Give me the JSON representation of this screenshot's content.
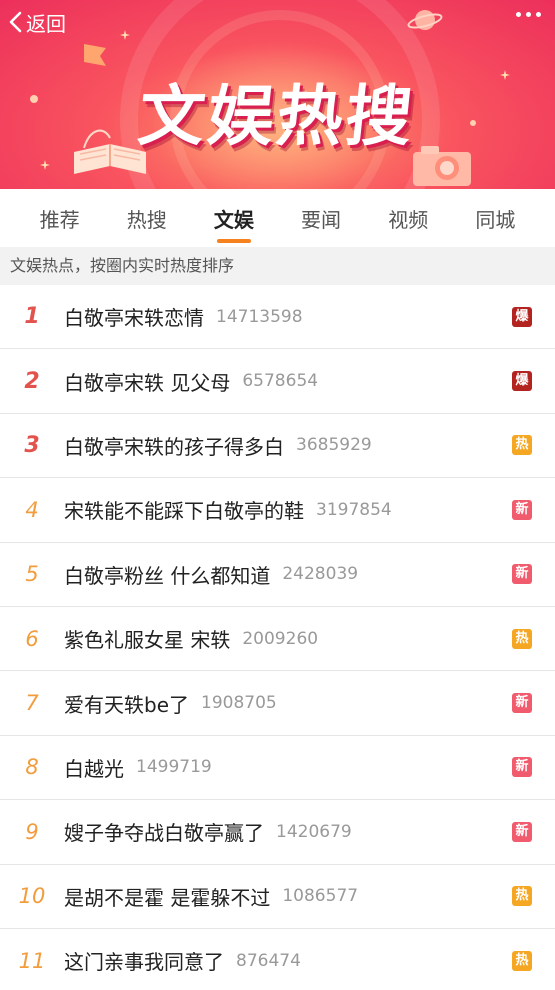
{
  "header": {
    "back_label": "返回",
    "banner_title": "文娱热搜"
  },
  "icons": {
    "back": "chevron-left-icon",
    "more": "more-dots-icon"
  },
  "tabs": [
    {
      "label": "推荐",
      "active": false
    },
    {
      "label": "热搜",
      "active": false
    },
    {
      "label": "文娱",
      "active": true
    },
    {
      "label": "要闻",
      "active": false
    },
    {
      "label": "视频",
      "active": false
    },
    {
      "label": "同城",
      "active": false
    }
  ],
  "subheader": "文娱热点，按圈内实时热度排序",
  "badge_colors": {
    "爆": "#b3231f",
    "热": "#f5a623",
    "新": "#f05b6d"
  },
  "rank_colors": {
    "top": "#e3534d",
    "normal": "#f39c3d"
  },
  "items": [
    {
      "rank": "1",
      "topic": "白敬亭宋轶恋情",
      "count": "14713598",
      "badge": "爆"
    },
    {
      "rank": "2",
      "topic": "白敬亭宋轶 见父母",
      "count": "6578654",
      "badge": "爆"
    },
    {
      "rank": "3",
      "topic": "白敬亭宋轶的孩子得多白",
      "count": "3685929",
      "badge": "热"
    },
    {
      "rank": "4",
      "topic": "宋轶能不能踩下白敬亭的鞋",
      "count": "3197854",
      "badge": "新"
    },
    {
      "rank": "5",
      "topic": "白敬亭粉丝 什么都知道",
      "count": "2428039",
      "badge": "新"
    },
    {
      "rank": "6",
      "topic": "紫色礼服女星 宋轶",
      "count": "2009260",
      "badge": "热"
    },
    {
      "rank": "7",
      "topic": "爱有天轶be了",
      "count": "1908705",
      "badge": "新"
    },
    {
      "rank": "8",
      "topic": "白越光",
      "count": "1499719",
      "badge": "新"
    },
    {
      "rank": "9",
      "topic": "嫂子争夺战白敬亭赢了",
      "count": "1420679",
      "badge": "新"
    },
    {
      "rank": "10",
      "topic": "是胡不是霍 是霍躲不过",
      "count": "1086577",
      "badge": "热"
    },
    {
      "rank": "11",
      "topic": "这门亲事我同意了",
      "count": "876474",
      "badge": "热"
    }
  ]
}
